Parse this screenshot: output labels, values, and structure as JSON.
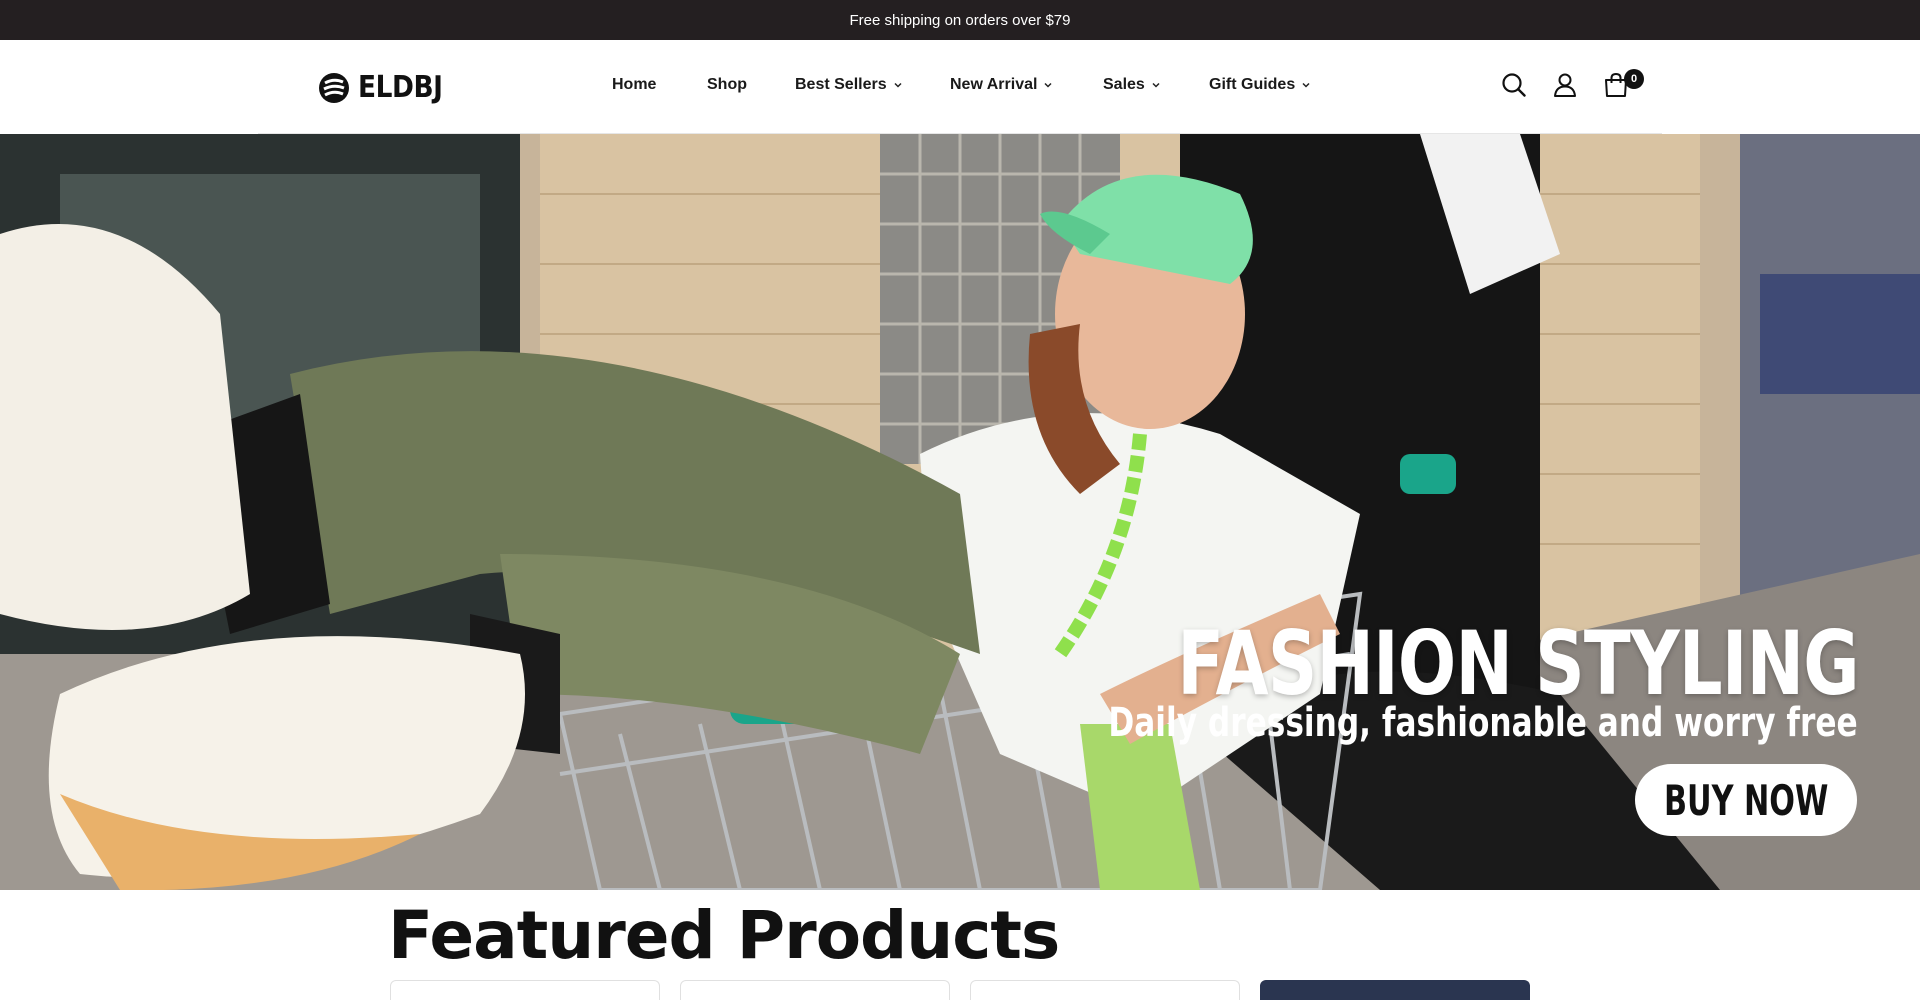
{
  "announcement": {
    "text": "Free shipping on orders over $79"
  },
  "brand": {
    "name": "ELDBJ"
  },
  "nav": {
    "items": [
      {
        "label": "Home",
        "has_dropdown": false
      },
      {
        "label": "Shop",
        "has_dropdown": false
      },
      {
        "label": "Best Sellers",
        "has_dropdown": true
      },
      {
        "label": "New Arrival",
        "has_dropdown": true
      },
      {
        "label": "Sales",
        "has_dropdown": true
      },
      {
        "label": "Gift Guides",
        "has_dropdown": true
      }
    ]
  },
  "header_icons": {
    "search": "search-icon",
    "account": "user-icon",
    "cart": "shopping-bag-icon",
    "cart_count": "0"
  },
  "hero": {
    "title": "FASHION STYLING",
    "subtitle": "Daily dressing, fashionable and worry free",
    "cta_label": "BUY NOW"
  },
  "featured": {
    "title": "Featured Products"
  },
  "colors": {
    "announce_bg": "#241f21",
    "text": "#111111",
    "accent_mint": "#7fe0a8",
    "cart_teal": "#1aa58a"
  }
}
